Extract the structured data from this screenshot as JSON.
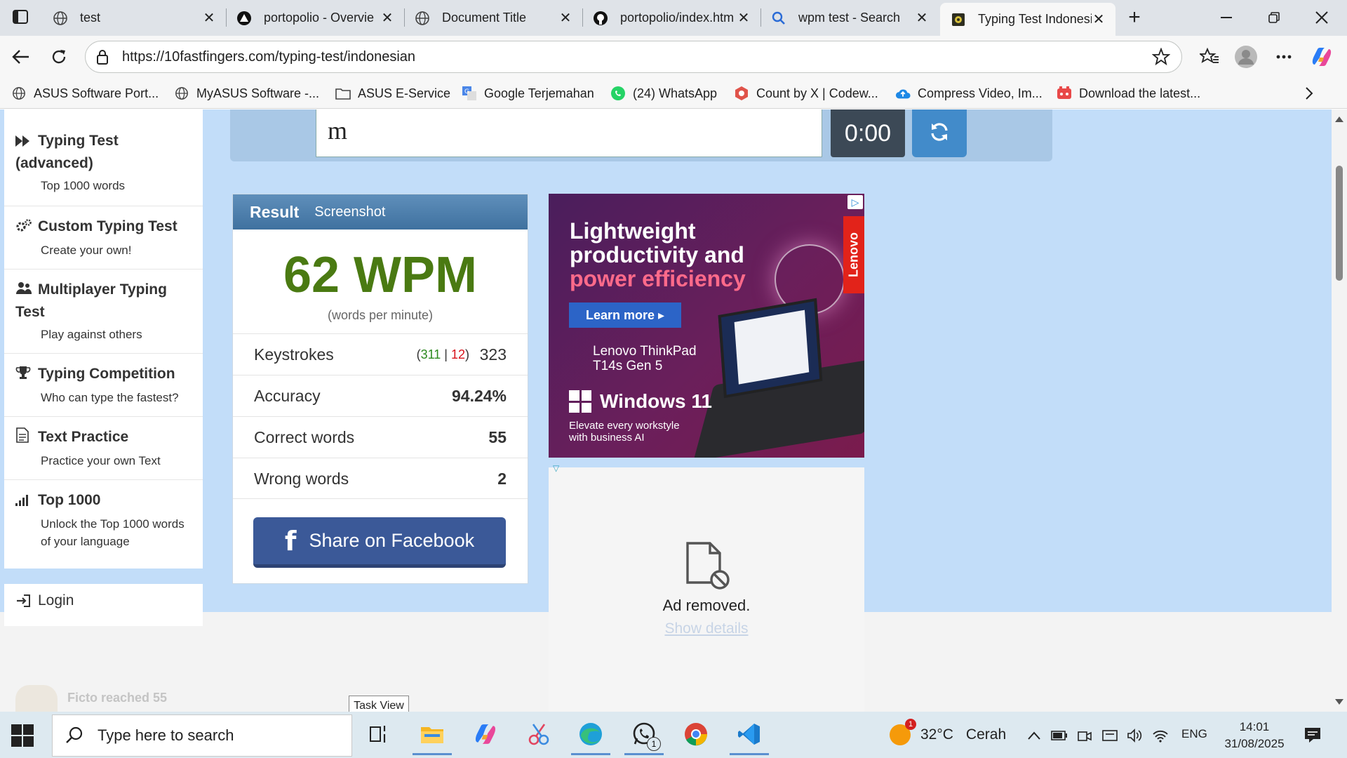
{
  "browser": {
    "tabs": [
      {
        "title": "test",
        "icon": "globe-icon",
        "active": false
      },
      {
        "title": "portopolio - Overvie",
        "icon": "vercel-icon",
        "active": false
      },
      {
        "title": "Document Title",
        "icon": "globe-icon",
        "active": false
      },
      {
        "title": "portopolio/index.htm",
        "icon": "github-icon",
        "active": false
      },
      {
        "title": "wpm test - Search",
        "icon": "search-icon",
        "active": false
      },
      {
        "title": "Typing Test Indonesi",
        "icon": "10fastfingers-icon",
        "active": true
      }
    ],
    "url": "https://10fastfingers.com/typing-test/indonesian",
    "bookmarks": [
      {
        "label": "ASUS Software Port...",
        "icon": "globe-icon"
      },
      {
        "label": "MyASUS Software -...",
        "icon": "globe-icon"
      },
      {
        "label": "ASUS E-Service",
        "icon": "folder-icon"
      },
      {
        "label": "Google Terjemahan",
        "icon": "translate-icon"
      },
      {
        "label": "(24) WhatsApp",
        "icon": "whatsapp-icon"
      },
      {
        "label": "Count by X | Codew...",
        "icon": "codewars-icon"
      },
      {
        "label": "Compress Video, Im...",
        "icon": "cloud-upload-icon"
      },
      {
        "label": "Download the latest...",
        "icon": "gamepad-icon"
      }
    ]
  },
  "sidebar": {
    "items": [
      {
        "title": "Typing Test (advanced)",
        "subtitle": "Top 1000 words",
        "icon": "fast-forward-icon"
      },
      {
        "title": "Custom Typing Test",
        "subtitle": "Create your own!",
        "icon": "gears-icon"
      },
      {
        "title": "Multiplayer Typing Test",
        "subtitle": "Play against others",
        "icon": "users-icon"
      },
      {
        "title": "Typing Competition",
        "subtitle": "Who can type the fastest?",
        "icon": "trophy-icon"
      },
      {
        "title": "Text Practice",
        "subtitle": "Practice your own Text",
        "icon": "document-icon"
      },
      {
        "title": "Top 1000",
        "subtitle": "Unlock the Top 1000 words of your language",
        "icon": "signal-bars-icon"
      }
    ],
    "login": "Login"
  },
  "typing": {
    "input_value": "m",
    "timer": "0:00"
  },
  "result": {
    "header_title": "Result",
    "header_tab": "Screenshot",
    "wpm": "62 WPM",
    "wpm_caption": "(words per minute)",
    "keystrokes_label": "Keystrokes",
    "keystrokes_correct": "311",
    "keystrokes_wrong": "12",
    "keystrokes_total": "323",
    "accuracy_label": "Accuracy",
    "accuracy_value": "94.24%",
    "correct_label": "Correct words",
    "correct_value": "55",
    "wrong_label": "Wrong words",
    "wrong_value": "2",
    "share_label": "Share on Facebook"
  },
  "ad": {
    "headline_1": "Lightweight",
    "headline_2": "productivity and",
    "headline_3": "power efficiency",
    "cta": "Learn more ▸",
    "model_1": "Lenovo ThinkPad",
    "model_2": "T14s Gen 5",
    "os": "Windows 11",
    "tagline_1": "Elevate every workstyle",
    "tagline_2": "with business AI",
    "brand": "Lenovo",
    "removed_text": "Ad removed.",
    "removed_link": "Show details"
  },
  "lower": {
    "faded_text": "Ficto reached 55"
  },
  "tooltip": "Task View",
  "taskbar": {
    "search_placeholder": "Type here to search",
    "weather_temp": "32°C",
    "weather_cond": "Cerah",
    "weather_badge": "1",
    "language": "ENG",
    "time": "14:01",
    "date": "31/08/2025",
    "whatsapp_badge": "1"
  },
  "colors": {
    "page_bg": "#c2ddf9",
    "wpm_green": "#4a7a12",
    "correct_green": "#2c8a1e",
    "wrong_red": "#d8131b",
    "facebook_blue": "#3b5998",
    "timer_bg": "#3c4956",
    "reload_blue": "#428bca"
  }
}
